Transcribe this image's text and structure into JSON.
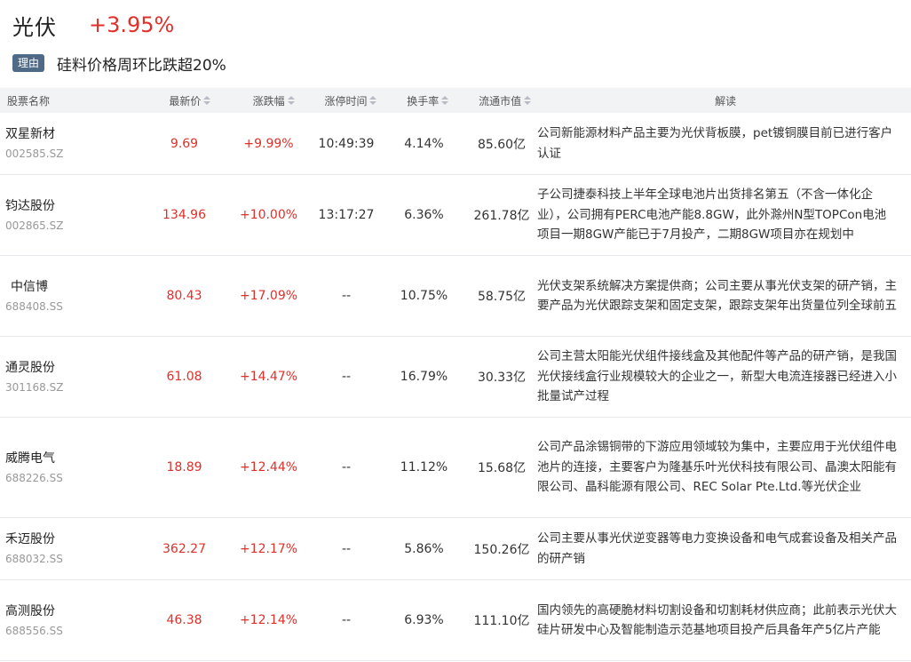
{
  "header": {
    "sector_name": "光伏",
    "sector_change": "+3.95%"
  },
  "reason": {
    "badge": "理由",
    "text": "硅料价格周环比跌超20%"
  },
  "columns": {
    "name": "股票名称",
    "price": "最新价",
    "change": "涨跌幅",
    "limit_time": "涨停时间",
    "turnover": "换手率",
    "market_cap": "流通市值",
    "description": "解读"
  },
  "colors": {
    "up": "#e0302a",
    "badge": "#4f6a86"
  },
  "rows": [
    {
      "name": "双星新材",
      "code": "002585.SZ",
      "price": "9.69",
      "change": "+9.99%",
      "limit_time": "10:49:39",
      "turnover": "4.14%",
      "market_cap": "85.60亿",
      "description": "公司新能源材料产品主要为光伏背板膜，pet镀铜膜目前已进行客户认证"
    },
    {
      "name": "钧达股份",
      "code": "002865.SZ",
      "price": "134.96",
      "change": "+10.00%",
      "limit_time": "13:17:27",
      "turnover": "6.36%",
      "market_cap": "261.78亿",
      "description": "子公司捷泰科技上半年全球电池片出货排名第五（不含一体化企业），公司拥有PERC电池产能8.8GW，此外滁州N型TOPCon电池项目一期8GW产能已于7月投产，二期8GW项目亦在规划中"
    },
    {
      "name": "中信博",
      "code": "688408.SS",
      "price": "80.43",
      "change": "+17.09%",
      "limit_time": "--",
      "turnover": "10.75%",
      "market_cap": "58.75亿",
      "description": "光伏支架系统解决方案提供商；公司主要从事光伏支架的研产销，主要产品为光伏跟踪支架和固定支架，跟踪支架年出货量位列全球前五"
    },
    {
      "name": "通灵股份",
      "code": "301168.SZ",
      "price": "61.08",
      "change": "+14.47%",
      "limit_time": "--",
      "turnover": "16.79%",
      "market_cap": "30.33亿",
      "description": "公司主营太阳能光伏组件接线盒及其他配件等产品的研产销，是我国光伏接线盒行业规模较大的企业之一，新型大电流连接器已经进入小批量试产过程"
    },
    {
      "name": "威腾电气",
      "code": "688226.SS",
      "price": "18.89",
      "change": "+12.44%",
      "limit_time": "--",
      "turnover": "11.12%",
      "market_cap": "15.68亿",
      "description": "公司产品涂锡铜带的下游应用领域较为集中，主要应用于光伏组件电池片的连接，主要客户为隆基乐叶光伏科技有限公司、晶澳太阳能有限公司、晶科能源有限公司、REC Solar Pte.Ltd.等光伏企业"
    },
    {
      "name": "禾迈股份",
      "code": "688032.SS",
      "price": "362.27",
      "change": "+12.17%",
      "limit_time": "--",
      "turnover": "5.86%",
      "market_cap": "150.26亿",
      "description": "公司主要从事光伏逆变器等电力变换设备和电气成套设备及相关产品的研产销"
    },
    {
      "name": "高测股份",
      "code": "688556.SS",
      "price": "46.38",
      "change": "+12.14%",
      "limit_time": "--",
      "turnover": "6.93%",
      "market_cap": "111.10亿",
      "description": "国内领先的高硬脆材料切割设备和切割耗材供应商；此前表示光伏大硅片研发中心及智能制造示范基地项目投产后具备年产5亿片产能"
    }
  ]
}
